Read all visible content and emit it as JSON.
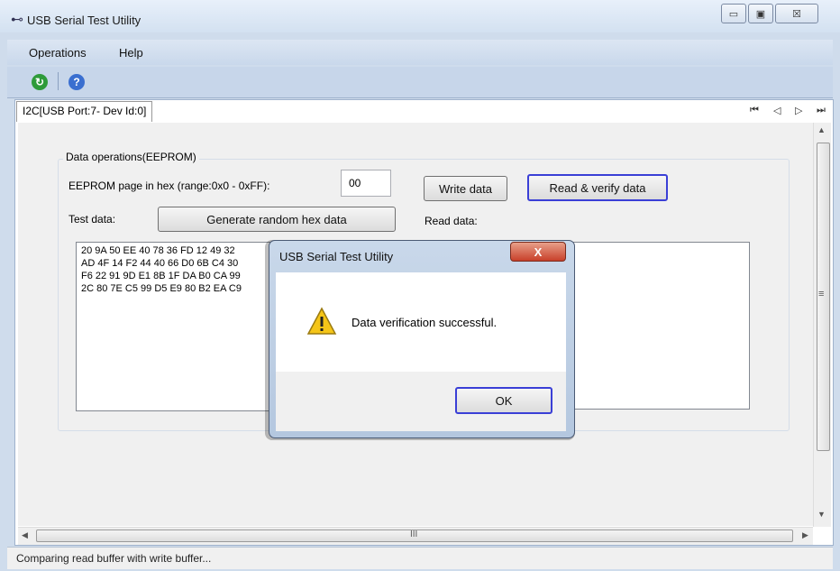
{
  "window": {
    "title": "USB Serial Test Utility",
    "controls": [
      "minimize",
      "maximize",
      "close"
    ]
  },
  "menu": [
    "Operations",
    "Help"
  ],
  "toolbar": {
    "icons": [
      "refresh-icon",
      "help-icon"
    ]
  },
  "tab": {
    "label": "I2C[USB Port:7- Dev Id:0]",
    "nav": [
      "first",
      "previous",
      "next",
      "last"
    ]
  },
  "eeprom": {
    "group_title": "Data operations(EEPROM)",
    "page_label": "EEPROM page in hex (range:0x0 - 0xFF):",
    "page_value": "00",
    "write_button": "Write data",
    "read_verify_button": "Read & verify data",
    "test_data_label": "Test data:",
    "generate_button": "Generate random hex data",
    "read_data_label": "Read data:",
    "test_data_lines": [
      "20 9A 50 EE 40 78 36 FD 12 49 32",
      "AD 4F 14 F2 44 40 66 D0 6B C4 30",
      "F6 22 91 9D E1 8B 1F DA B0 CA 99",
      "2C 80 7E C5 99 D5 E9 80 B2 EA C9"
    ]
  },
  "scroll": {
    "hscroll_grip": "III",
    "vscroll_grip": "≡"
  },
  "status": {
    "text": "Comparing read buffer with write buffer..."
  },
  "dialog": {
    "title": "USB Serial Test Utility",
    "close_glyph": "X",
    "message": "Data verification successful.",
    "ok_button": "OK"
  }
}
